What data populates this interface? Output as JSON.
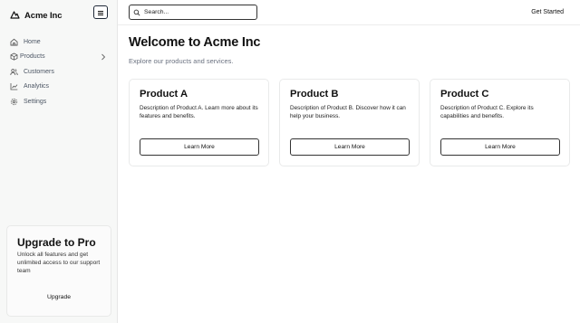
{
  "app": {
    "name": "Acme Inc",
    "logo_icon": "mountain-logo-icon",
    "menu_icon": "menu-toggle-icon"
  },
  "sidebar": {
    "items": [
      {
        "label": "Home",
        "icon": "home-icon"
      },
      {
        "label": "Products",
        "icon": "package-icon",
        "has_submenu": true
      },
      {
        "label": "Customers",
        "icon": "users-icon"
      },
      {
        "label": "Analytics",
        "icon": "line-chart-icon"
      },
      {
        "label": "Settings",
        "icon": "gear-icon"
      }
    ],
    "upgrade": {
      "title": "Upgrade to Pro",
      "description": "Unlock all features and get unlimited access to our support team",
      "button_label": "Upgrade"
    }
  },
  "header": {
    "search_placeholder": "Search...",
    "get_started_label": "Get Started"
  },
  "main": {
    "title": "Welcome to Acme Inc",
    "subtitle": "Explore our products and services.",
    "cards": [
      {
        "title": "Product A",
        "description": "Description of Product A. Learn more about its features and benefits.",
        "button_label": "Learn More"
      },
      {
        "title": "Product B",
        "description": "Description of Product B. Discover how it can help your business.",
        "button_label": "Learn More"
      },
      {
        "title": "Product C",
        "description": "Description of Product C. Explore its capabilities and benefits.",
        "button_label": "Learn More"
      }
    ]
  },
  "colors": {
    "sidebar_bg": "#f7f8f7",
    "text_primary": "#111111",
    "text_muted": "#6b7280",
    "border": "#e9eaea"
  }
}
